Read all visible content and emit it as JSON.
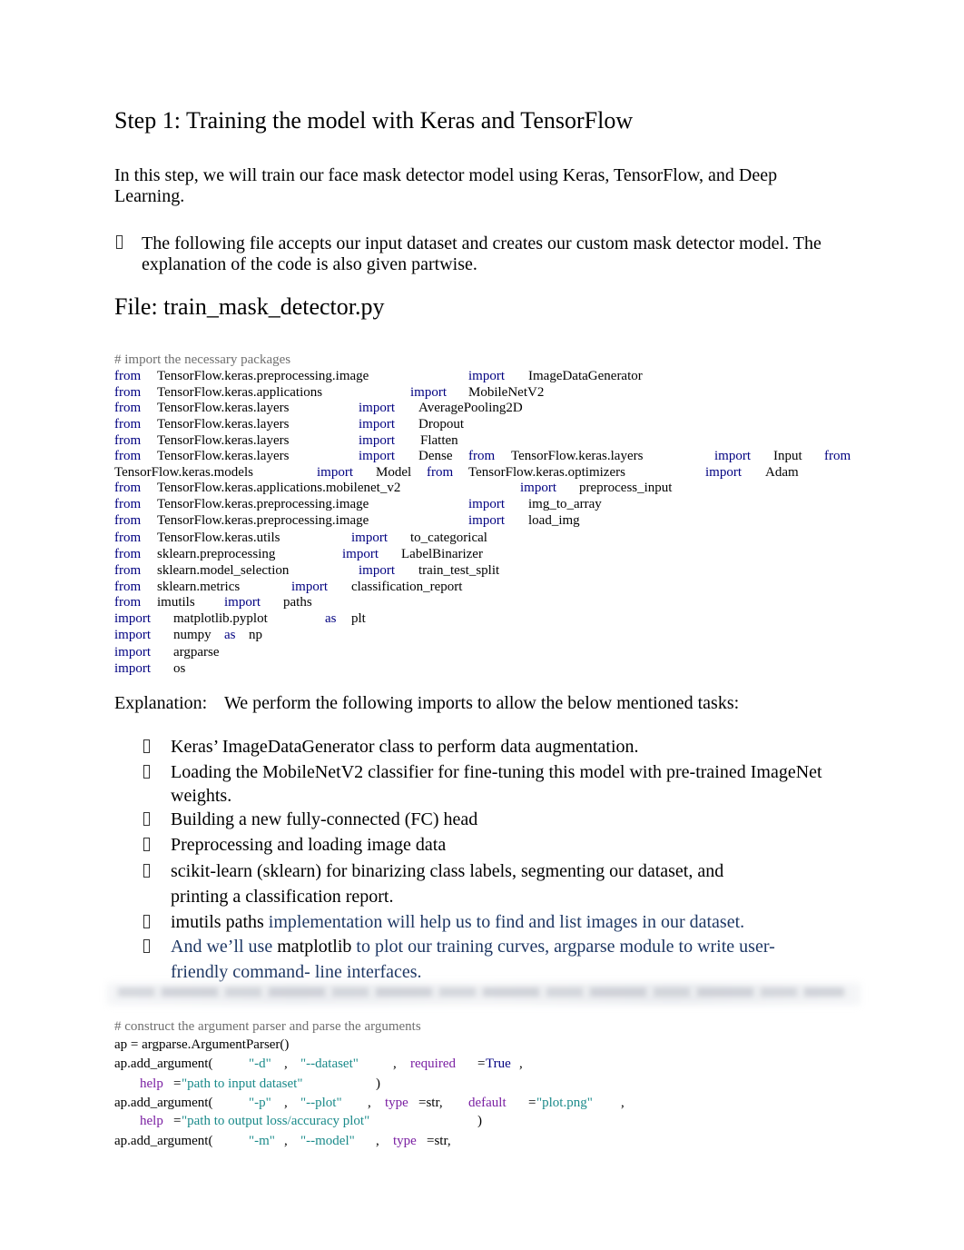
{
  "heading": "Step 1: Training the model with Keras and TensorFlow",
  "intro": "In this step, we will train our face mask detector model using Keras, TensorFlow, and Deep Learning.",
  "bullet_intro": "The following file accepts our input dataset and creates our custom mask detector model. The explanation of the code is also given partwise.",
  "file_heading": "File: train_mask_detector.py",
  "bullet_icon": "missing-glyph-box",
  "code_imports": {
    "comment": "# import the necessary packages",
    "lines": [
      {
        "a": "from",
        "b": "TensorFlow.keras.preprocessing.image",
        "c": "import",
        "d": "ImageDataGenerator"
      },
      {
        "a": "from",
        "b": "TensorFlow.keras.applications",
        "c": "import",
        "d": "MobileNetV2"
      },
      {
        "a": "from",
        "b": "TensorFlow.keras.layers",
        "c": "import",
        "d": "AveragePooling2D"
      },
      {
        "a": "from",
        "b": "TensorFlow.keras.layers",
        "c": "import",
        "d": "Dropout"
      },
      {
        "a": "from",
        "b": "TensorFlow.keras.layers",
        "c": "import",
        "d": "Flatten"
      },
      {
        "a": "from",
        "b": "TensorFlow.keras.layers",
        "c": "import",
        "d": "Dense",
        "e": "from",
        "f": "TensorFlow.keras.layers",
        "g": "import",
        "h": "Input",
        "i": "from"
      },
      {
        "a": "TensorFlow.keras.models",
        "b": "import",
        "c": "Model",
        "d": "from",
        "e": "TensorFlow.keras.optimizers",
        "f": "import",
        "g": "Adam"
      },
      {
        "a": "from",
        "b": "TensorFlow.keras.applications.mobilenet_v2",
        "c": "import",
        "d": "preprocess_input"
      },
      {
        "a": "from",
        "b": "TensorFlow.keras.preprocessing.image",
        "c": "import",
        "d": "img_to_array"
      },
      {
        "a": "from",
        "b": "TensorFlow.keras.preprocessing.image",
        "c": "import",
        "d": "load_img"
      },
      {
        "a": "from",
        "b": "TensorFlow.keras.utils",
        "c": "import",
        "d": "to_categorical"
      },
      {
        "a": "from",
        "b": "sklearn.preprocessing",
        "c": "import",
        "d": "LabelBinarizer"
      },
      {
        "a": "from",
        "b": "sklearn.model_selection",
        "c": "import",
        "d": "train_test_split"
      },
      {
        "a": "from",
        "b": "sklearn.metrics",
        "c": "import",
        "d": "classification_report"
      },
      {
        "a": "from",
        "b": "imutils",
        "c": "import",
        "d": "paths"
      },
      {
        "a": "import",
        "b": "matplotlib.pyplot",
        "c": "as",
        "d": "plt"
      },
      {
        "a": "import",
        "b": "numpy",
        "c": "as",
        "d": "np"
      },
      {
        "a": "import",
        "b": "argparse"
      },
      {
        "a": "import",
        "b": "os"
      }
    ]
  },
  "explanation": {
    "label": "Explanation:",
    "text": "We perform the following imports to allow the below mentioned tasks:",
    "items": [
      {
        "line1": "Keras’ ImageDataGenerator class to perform data augmentation."
      },
      {
        "line1": "Loading the MobileNetV2 classifier for fine-tuning this model with pre-trained ImageNet",
        "line2": "weights."
      },
      {
        "line1": "Building a new fully-connected (FC) head"
      },
      {
        "line1": "Preprocessing and loading image data"
      },
      {
        "line1": "scikit-learn (sklearn) for binarizing class labels, segmenting our dataset, and",
        "line2": "printing a classification report."
      },
      {
        "p1": "imutils paths",
        "p2": " implementation will help us to find and list images in our dataset."
      },
      {
        "p1": "And we’ll use ",
        "p2": "matplotlib",
        "p3": " to plot our training curves, argparse module to write user-",
        "line2": "friendly command- line interfaces."
      }
    ]
  },
  "code_args": {
    "comment": "# construct the argument parser and parse the arguments",
    "l1": "ap = argparse.ArgumentParser()",
    "l2": {
      "fn": "ap.add_argument(",
      "s1": "\"-d\"",
      "c1": ",",
      "s2": "\"--dataset\"",
      "c2": ",",
      "k": "required",
      "eq": "=",
      "v": "True",
      "c3": ","
    },
    "l3": {
      "k": "help",
      "eq": "=",
      "s": "\"path to input dataset\"",
      "close": ")"
    },
    "l4": {
      "fn": "ap.add_argument(",
      "s1": "\"-p\"",
      "c1": ",",
      "s2": "\"--plot\"",
      "c2": ",",
      "k1": "type",
      "v1": "=str,",
      "k2": "default",
      "eq": "=",
      "s3": "\"plot.png\"",
      "c3": ","
    },
    "l5": {
      "k": "help",
      "eq": "=",
      "s": "\"path to output loss/accuracy plot\"",
      "close": ")"
    },
    "l6": {
      "fn": "ap.add_argument(",
      "s1": "\"-m\"",
      "c1": ",",
      "s2": "\"--model\"",
      "c2": ",",
      "k1": "type",
      "v1": "=str,"
    }
  }
}
